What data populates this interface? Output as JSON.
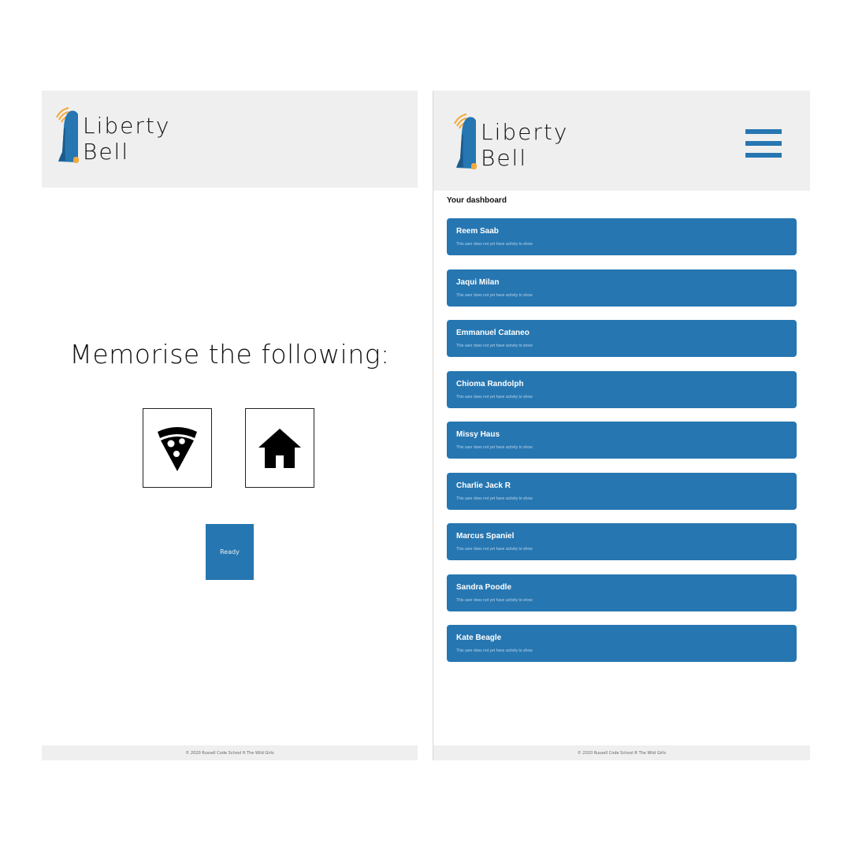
{
  "left": {
    "logo": {
      "line1": "Liberty",
      "line2": "Bell"
    },
    "title": "Memorise the following:",
    "cards": [
      {
        "icon": "pizza-slice-icon"
      },
      {
        "icon": "house-icon"
      }
    ],
    "ready_label": "Ready",
    "footer": "© 2020 Russell Code School ft The Wild Girls"
  },
  "right": {
    "logo": {
      "line1": "Liberty",
      "line2": "Bell"
    },
    "menu_icon": "hamburger-menu-icon",
    "dashboard_title": "Your dashboard",
    "users": [
      {
        "name": "Reem Saab",
        "status": "This user does not yet have activity to show"
      },
      {
        "name": "Jaqui Milan",
        "status": "This user does not yet have activity to show"
      },
      {
        "name": "Emmanuel Cataneo",
        "status": "This user does not yet have activity to show"
      },
      {
        "name": "Chioma Randolph",
        "status": "This user does not yet have activity to show"
      },
      {
        "name": "Missy Haus",
        "status": "This user does not yet have activity to show"
      },
      {
        "name": "Charlie Jack R",
        "status": "This user does not yet have activity to show"
      },
      {
        "name": "Marcus Spaniel",
        "status": "This user does not yet have activity to show"
      },
      {
        "name": "Sandra Poodle",
        "status": "This user does not yet have activity to show"
      },
      {
        "name": "Kate Beagle",
        "status": "This user does not yet have activity to show"
      }
    ],
    "footer": "© 2020 Russell Code School ft The Wild Girls"
  },
  "colors": {
    "accent": "#2676b1",
    "header_bg": "#efefef",
    "logo_wave": "#f2a93b"
  }
}
